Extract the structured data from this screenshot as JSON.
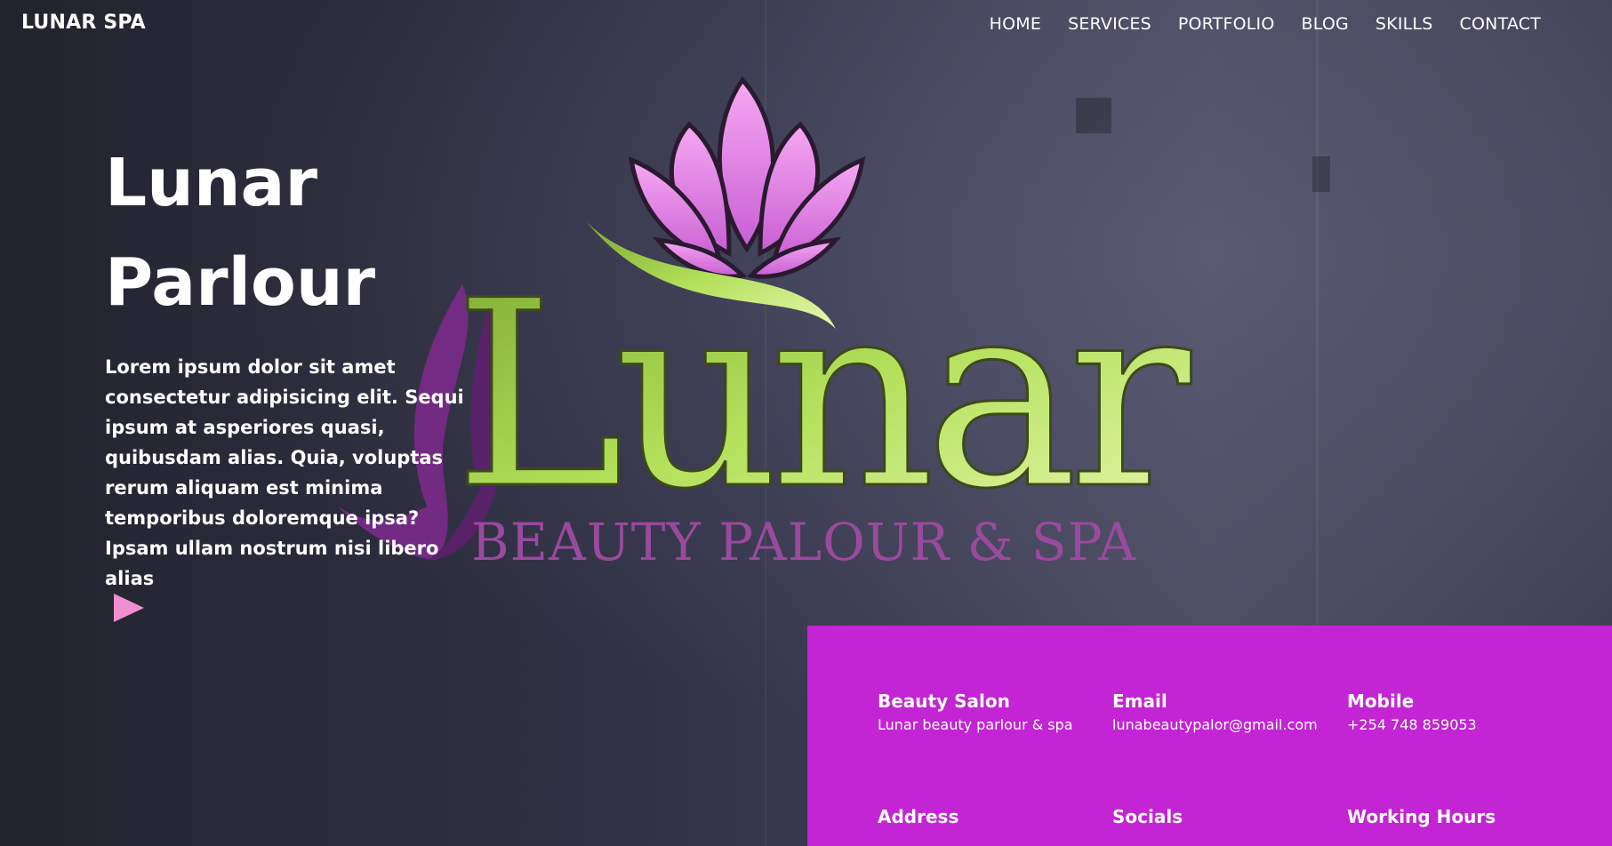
{
  "header": {
    "brand": "LUNAR SPA",
    "nav": [
      "HOME",
      "SERVICES",
      "PORTFOLIO",
      "BLOG",
      "SKILLS",
      "CONTACT"
    ]
  },
  "hero": {
    "title_line1": "Lunar",
    "title_line2": "Parlour",
    "description": "Lorem ipsum dolor sit amet consectetur adipisicing elit. Sequi ipsum at asperiores quasi, quibusdam alias. Quia, voluptas rerum aliquam est minima temporibus doloremque ipsa? Ipsam ullam nostrum nisi libero alias",
    "play_icon": "play-icon"
  },
  "logo": {
    "wordmark": "Lunar",
    "tagline": "BEAUTY PALOUR & SPA",
    "colors": {
      "lotus": "#e27ee8",
      "wordmark": "#a6d94a",
      "figure": "#7a2a8a"
    }
  },
  "info": {
    "items": [
      {
        "title": "Beauty Salon",
        "value": "Lunar beauty parlour & spa"
      },
      {
        "title": "Email",
        "value": "lunabeautypalor@gmail.com"
      },
      {
        "title": "Mobile",
        "value": "+254 748 859053"
      },
      {
        "title": "Address",
        "value": ""
      },
      {
        "title": "Socials",
        "value": ""
      },
      {
        "title": "Working Hours",
        "value": ""
      }
    ],
    "panel_color": "#c324d4"
  }
}
